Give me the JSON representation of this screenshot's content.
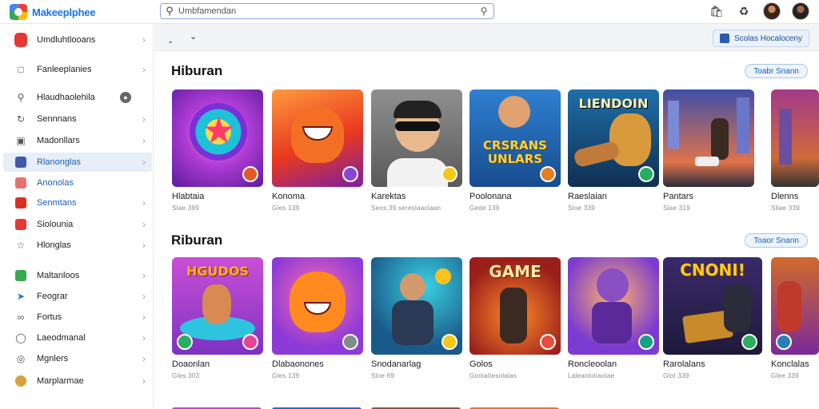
{
  "app": {
    "name": "Makeeplphee"
  },
  "search": {
    "value": "Umbfamendan"
  },
  "sidebar": {
    "items": [
      {
        "label": "Umdluhtlooans",
        "icon": "red-app-icon"
      },
      {
        "label": "Fanleeplanies",
        "icon": "document-icon"
      },
      {
        "label": "Hlaudhaolehila",
        "icon": "search-icon",
        "badge": "●"
      },
      {
        "label": "Sennnans",
        "icon": "refresh-icon"
      },
      {
        "label": "Madonllars",
        "icon": "monitor-icon"
      },
      {
        "label": "Rlanonglas",
        "icon": "chart-icon"
      },
      {
        "label": "Anonolas",
        "icon": "red-grid-icon"
      },
      {
        "label": "Senmtans",
        "icon": "red-book-icon"
      },
      {
        "label": "Siolounia",
        "icon": "red-square-icon"
      },
      {
        "label": "Hlonglas",
        "icon": "star-outline-icon"
      },
      {
        "label": "Maltanloos",
        "icon": "green-square-icon"
      },
      {
        "label": "Feograr",
        "icon": "tag-icon"
      },
      {
        "label": "Fortus",
        "icon": "link-icon"
      },
      {
        "label": "Laeodmanal",
        "icon": "circle-icon"
      },
      {
        "label": "Mgnlers",
        "icon": "location-icon"
      },
      {
        "label": "Marplarmae",
        "icon": "avatar-icon"
      }
    ]
  },
  "toolbar": {
    "btn_label": "Scolas Hocaloceny"
  },
  "sections": [
    {
      "title": "Hiburan",
      "see_all": "Toabr Snann",
      "cards": [
        {
          "title": "Hlabtaia",
          "meta": "Slae 399"
        },
        {
          "title": "Konoma",
          "meta": "Gles 139"
        },
        {
          "title": "Karektas",
          "meta": "Seos 39  sereslaaclaan"
        },
        {
          "title": "Poolonana",
          "meta": "Gede 139"
        },
        {
          "title": "Raeslaian",
          "meta": "Sloe 339"
        },
        {
          "title": "Pantars",
          "meta": "Slae 319"
        },
        {
          "title": "Dlenns",
          "meta": "Sllae 339"
        }
      ],
      "card_texts": [
        "",
        "",
        "",
        "CRSRANS UNLARS",
        "LIENDOIN",
        "",
        ""
      ]
    },
    {
      "title": "Riburan",
      "see_all": "Toaor Snann",
      "cards": [
        {
          "title": "Doaonlan",
          "meta": "Gles 303"
        },
        {
          "title": "Dlabaonones",
          "meta": "Gles 139"
        },
        {
          "title": "Snodanarlag",
          "meta": "Sloe 69"
        },
        {
          "title": "Golos",
          "meta": "Goolatlesolalas"
        },
        {
          "title": "Roncleoolan",
          "meta": "Laleaolotiaolae"
        },
        {
          "title": "Rarolalans",
          "meta": "Glot 339"
        },
        {
          "title": "Konclalas",
          "meta": "Glee 339"
        }
      ],
      "card_texts": [
        "HGUDOS",
        "",
        "",
        "GAME",
        "",
        "CNONI!",
        ""
      ]
    }
  ],
  "colors": {
    "accent": "#1a73e8",
    "active_bg": "#e8eef8"
  }
}
